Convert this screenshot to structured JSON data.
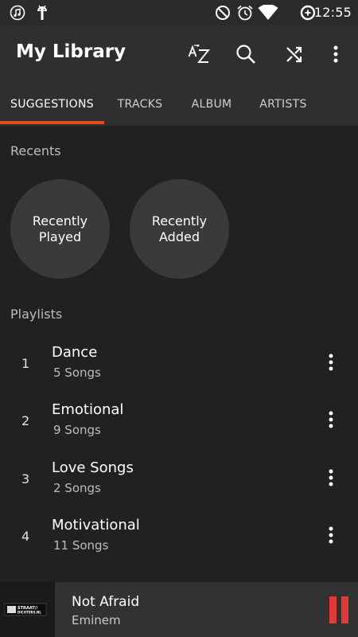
{
  "status_bar": {
    "time": "12:55",
    "left_icons": [
      "music-notification-icon",
      "android-debug-icon"
    ],
    "right_icons": [
      "do-not-disturb-icon",
      "alarm-icon",
      "wifi-icon",
      "data-saver-icon"
    ]
  },
  "toolbar": {
    "title": "My Library",
    "actions": [
      "sort-az-icon",
      "search-icon",
      "shuffle-icon",
      "more-vert-icon"
    ]
  },
  "tabs": [
    {
      "label": "SUGGESTIONS",
      "active": true
    },
    {
      "label": "TRACKS",
      "active": false
    },
    {
      "label": "ALBUM",
      "active": false
    },
    {
      "label": "ARTISTS",
      "active": false
    }
  ],
  "recents": {
    "label": "Recents",
    "items": [
      {
        "line1": "Recently",
        "line2": "Played"
      },
      {
        "line1": "Recently",
        "line2": "Added"
      }
    ]
  },
  "playlists": {
    "label": "Playlists",
    "items": [
      {
        "num": "1",
        "name": "Dance",
        "songs": "5 Songs"
      },
      {
        "num": "2",
        "name": "Emotional",
        "songs": "9 Songs"
      },
      {
        "num": "3",
        "name": "Love Songs",
        "songs": "2 Songs"
      },
      {
        "num": "4",
        "name": "Motivational",
        "songs": "11 Songs"
      }
    ]
  },
  "now_playing": {
    "title": "Not Afraid",
    "artist": "Eminem",
    "art_text_1": "STRAAT//",
    "art_text_2": "DICHTERS.NL",
    "state": "playing"
  },
  "colors": {
    "accent": "#e64a19",
    "pause": "#e53935",
    "background": "#212121",
    "toolbar": "#2f2f2f"
  }
}
